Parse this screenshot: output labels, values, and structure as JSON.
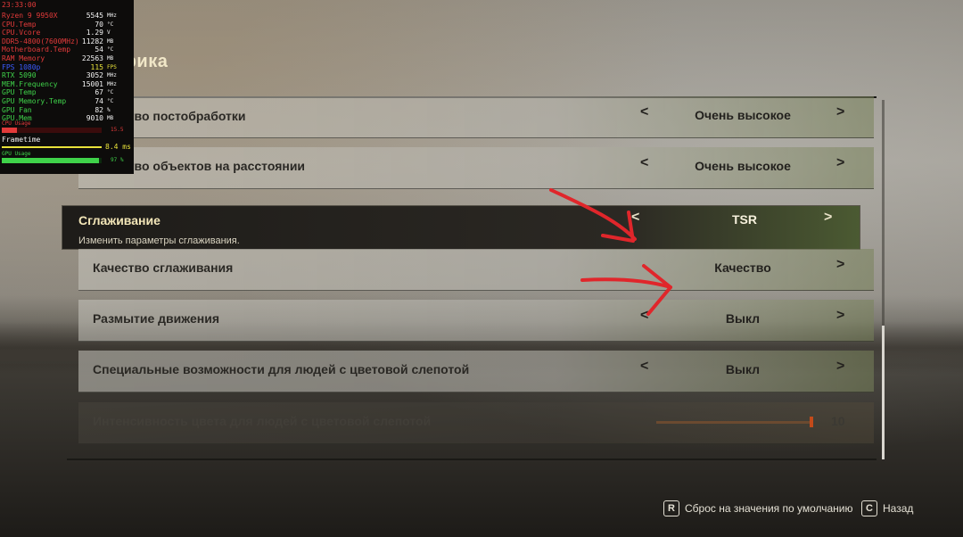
{
  "overlay": {
    "time": "23:33:00",
    "rows": [
      {
        "key": "Ryzen 9 9950X",
        "value": "5545",
        "unit": "MHz",
        "key_color": "red",
        "value_color": "white"
      },
      {
        "key": "CPU.Temp",
        "value": "70",
        "unit": "°C",
        "key_color": "red",
        "value_color": "white"
      },
      {
        "key": "CPU.Vcore",
        "value": "1.29",
        "unit": "V",
        "key_color": "red",
        "value_color": "white"
      },
      {
        "key": "DDR5-4800(7600MHz)",
        "value": "11282",
        "unit": "MB",
        "key_color": "red",
        "value_color": "white"
      },
      {
        "key": "Motherboard.Temp",
        "value": "54",
        "unit": "°C",
        "key_color": "red",
        "value_color": "white"
      },
      {
        "key": "RAM Memory",
        "value": "22563",
        "unit": "MB",
        "key_color": "red",
        "value_color": "white"
      },
      {
        "key": "FPS 1080p",
        "value": "115",
        "unit": "FPS",
        "key_color": "blue",
        "value_color": "yellow"
      },
      {
        "key": "RTX 5090",
        "value": "3052",
        "unit": "MHz",
        "key_color": "green",
        "value_color": "white"
      },
      {
        "key": "MEM.Frequency",
        "value": "15001",
        "unit": "MHz",
        "key_color": "green",
        "value_color": "white"
      },
      {
        "key": "GPU Temp",
        "value": "67",
        "unit": "°C",
        "key_color": "green",
        "value_color": "white"
      },
      {
        "key": "GPU Memory.Temp",
        "value": "74",
        "unit": "°C",
        "key_color": "green",
        "value_color": "white"
      },
      {
        "key": "GPU Fan",
        "value": "82",
        "unit": "%",
        "key_color": "green",
        "value_color": "white"
      },
      {
        "key": "GPU.Mem",
        "value": "9010",
        "unit": "MB",
        "key_color": "green",
        "value_color": "white"
      }
    ],
    "cpu_usage_label": "CPU Usage",
    "cpu_usage_value": "15.5",
    "cpu_usage_fraction": 0.155,
    "frametime_label": "Frametime",
    "frametime_value": "8.4 ms",
    "gpu_usage_label": "GPU Usage",
    "gpu_usage_value": "97 %",
    "gpu_usage_fraction": 0.97
  },
  "page": {
    "section_title": "Графика"
  },
  "settings": [
    {
      "label": "Качество постобработки",
      "value": "Очень высокое"
    },
    {
      "label": "Качество объектов на расстоянии",
      "value": "Очень высокое"
    },
    {
      "label": "Сглаживание",
      "value": "TSR",
      "description": "Изменить параметры сглаживания."
    },
    {
      "label": "Качество сглаживания",
      "value": "Качество"
    },
    {
      "label": "Размытие движения",
      "value": "Выкл"
    },
    {
      "label": "Специальные возможности для людей с цветовой слепотой",
      "value": "Выкл"
    },
    {
      "label": "Интенсивность цвета для людей с цветовой слепотой",
      "value": "10",
      "slider_fraction": 0.99
    }
  ],
  "arrows": {
    "left": "<",
    "right": ">"
  },
  "footer": {
    "reset_key": "R",
    "reset_label": "Сброс на значения по умолчанию",
    "back_key": "C",
    "back_label": "Назад"
  },
  "colors": {
    "annotation_red": "#e0262b",
    "selected_bg": "#1e1c19",
    "selected_text": "#f3e6b8",
    "slider_fill": "#c34a1a"
  }
}
